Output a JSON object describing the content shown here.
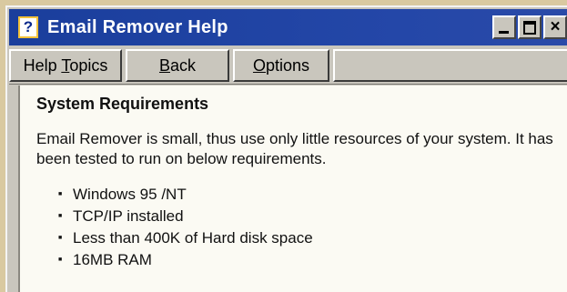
{
  "window": {
    "title": "Email Remover Help",
    "icon": "help-question-icon",
    "controls": {
      "minimize": "_",
      "maximize": "□",
      "close": "×"
    }
  },
  "toolbar": {
    "buttons": [
      {
        "prefix": "Help ",
        "accel": "T",
        "suffix": "opics"
      },
      {
        "prefix": "",
        "accel": "B",
        "suffix": "ack"
      },
      {
        "prefix": "",
        "accel": "O",
        "suffix": "ptions"
      }
    ]
  },
  "content": {
    "heading": "System Requirements",
    "paragraph": "Email Remover is small, thus use only little resources of your system.  It has been tested to run on below requirements.",
    "requirements": [
      "Windows 95 /NT",
      "TCP/IP installed",
      "Less than 400K of Hard disk space",
      "16MB RAM"
    ]
  },
  "colors": {
    "titlebar": "#1a3e9c",
    "chrome": "#c9c6bd",
    "content_bg": "#fbfaf3"
  }
}
